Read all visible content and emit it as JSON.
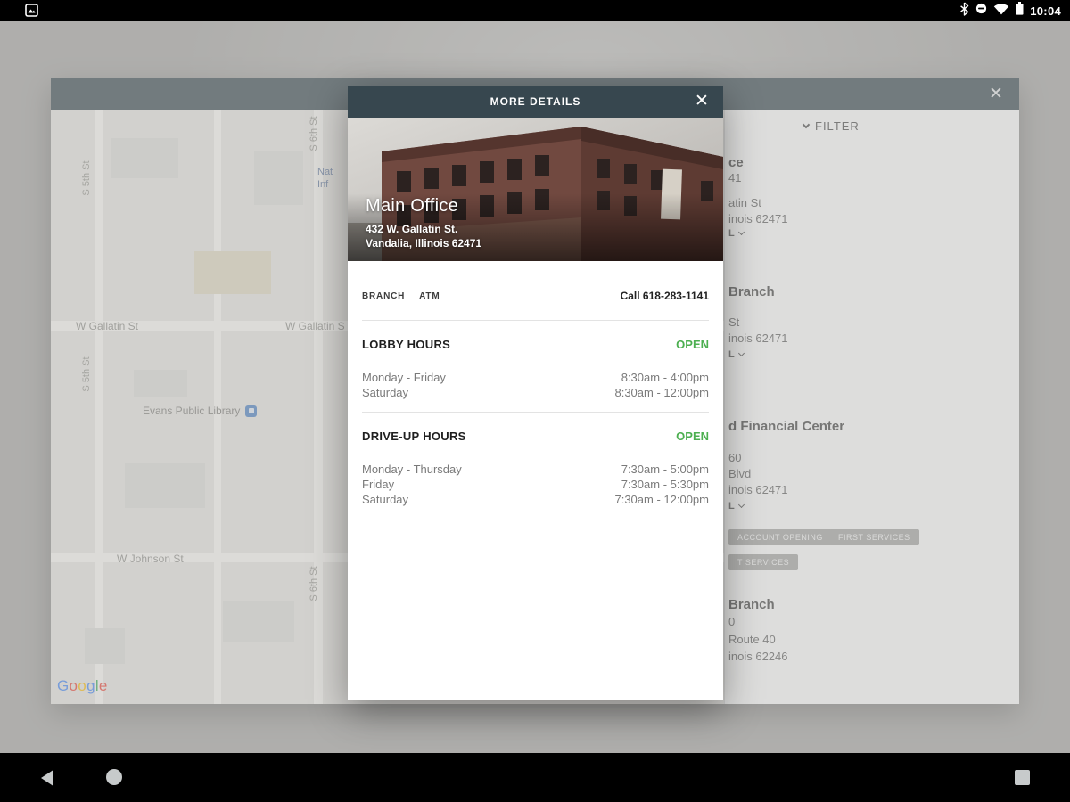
{
  "status_bar": {
    "time": "10:04",
    "icons": [
      "screenshot-notification",
      "bluetooth",
      "do-not-disturb",
      "wifi",
      "battery"
    ]
  },
  "nav_bar": {
    "icons": [
      "back",
      "home",
      "recents"
    ]
  },
  "app_window": {
    "close_icon": "✕",
    "filter_label": "FILTER"
  },
  "map": {
    "street_labels": {
      "gallatin_1": "W Gallatin St",
      "gallatin_2": "W Gallatin S",
      "johnson": "W Johnson St",
      "s5th_1": "S 5th St",
      "s5th_2": "S 5th St",
      "s6th_1": "S 6th St",
      "s6th_2": "S 6th St"
    },
    "poi": {
      "library": "Evans Public Library",
      "blue_line1": "Nat",
      "blue_line2": "Inf"
    },
    "google_logo": {
      "g1": "G",
      "o1": "o",
      "o2": "o",
      "g2": "g",
      "l1": "l",
      "e1": "e"
    }
  },
  "branch_list": {
    "items": [
      {
        "name": "ce",
        "phone": "41",
        "addr1": "atin St",
        "addr2": "inois 62471",
        "more": "L"
      },
      {
        "name": "Branch",
        "addr1": "St",
        "addr2": "inois 62471",
        "more": "L"
      },
      {
        "name": "d Financial Center",
        "phone": "60",
        "addr1": "Blvd",
        "addr2": "inois 62471",
        "more": "L",
        "chips": [
          "ACCOUNT OPENING",
          "FIRST SERVICES",
          "T SERVICES"
        ]
      },
      {
        "name": "Branch",
        "phone": "0",
        "addr1": "Route 40",
        "addr2": "inois 62246"
      }
    ]
  },
  "modal": {
    "title": "MORE DETAILS",
    "close_icon": "✕",
    "hero": {
      "name": "Main Office",
      "address_line1": "432 W. Gallatin St.",
      "address_line2": "Vandalia, Illinois 62471"
    },
    "meta": {
      "types": [
        "BRANCH",
        "ATM"
      ],
      "call": "Call 618-283-1141"
    },
    "sections": [
      {
        "title": "LOBBY HOURS",
        "status": "OPEN",
        "rows": [
          {
            "label": "Monday - Friday",
            "value": "8:30am - 4:00pm"
          },
          {
            "label": "Saturday",
            "value": "8:30am - 12:00pm"
          }
        ]
      },
      {
        "title": "DRIVE-UP HOURS",
        "status": "OPEN",
        "rows": [
          {
            "label": "Monday - Thursday",
            "value": "7:30am - 5:00pm"
          },
          {
            "label": "Friday",
            "value": "7:30am - 5:30pm"
          },
          {
            "label": "Saturday",
            "value": "7:30am - 12:00pm"
          }
        ]
      }
    ]
  },
  "colors": {
    "open_green": "#4caf50",
    "header_dark": "#37474f",
    "pin_blue": "#4a7fc1"
  }
}
